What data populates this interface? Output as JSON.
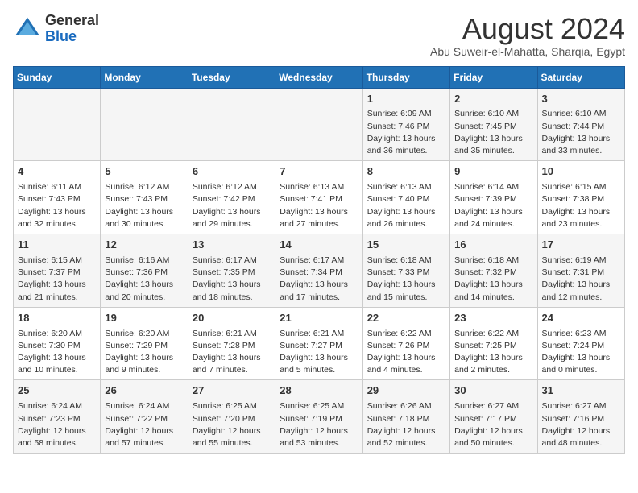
{
  "logo": {
    "general": "General",
    "blue": "Blue"
  },
  "title": "August 2024",
  "location": "Abu Suweir-el-Mahatta, Sharqia, Egypt",
  "days_header": [
    "Sunday",
    "Monday",
    "Tuesday",
    "Wednesday",
    "Thursday",
    "Friday",
    "Saturday"
  ],
  "weeks": [
    [
      {
        "day": "",
        "info": ""
      },
      {
        "day": "",
        "info": ""
      },
      {
        "day": "",
        "info": ""
      },
      {
        "day": "",
        "info": ""
      },
      {
        "day": "1",
        "info": "Sunrise: 6:09 AM\nSunset: 7:46 PM\nDaylight: 13 hours\nand 36 minutes."
      },
      {
        "day": "2",
        "info": "Sunrise: 6:10 AM\nSunset: 7:45 PM\nDaylight: 13 hours\nand 35 minutes."
      },
      {
        "day": "3",
        "info": "Sunrise: 6:10 AM\nSunset: 7:44 PM\nDaylight: 13 hours\nand 33 minutes."
      }
    ],
    [
      {
        "day": "4",
        "info": "Sunrise: 6:11 AM\nSunset: 7:43 PM\nDaylight: 13 hours\nand 32 minutes."
      },
      {
        "day": "5",
        "info": "Sunrise: 6:12 AM\nSunset: 7:43 PM\nDaylight: 13 hours\nand 30 minutes."
      },
      {
        "day": "6",
        "info": "Sunrise: 6:12 AM\nSunset: 7:42 PM\nDaylight: 13 hours\nand 29 minutes."
      },
      {
        "day": "7",
        "info": "Sunrise: 6:13 AM\nSunset: 7:41 PM\nDaylight: 13 hours\nand 27 minutes."
      },
      {
        "day": "8",
        "info": "Sunrise: 6:13 AM\nSunset: 7:40 PM\nDaylight: 13 hours\nand 26 minutes."
      },
      {
        "day": "9",
        "info": "Sunrise: 6:14 AM\nSunset: 7:39 PM\nDaylight: 13 hours\nand 24 minutes."
      },
      {
        "day": "10",
        "info": "Sunrise: 6:15 AM\nSunset: 7:38 PM\nDaylight: 13 hours\nand 23 minutes."
      }
    ],
    [
      {
        "day": "11",
        "info": "Sunrise: 6:15 AM\nSunset: 7:37 PM\nDaylight: 13 hours\nand 21 minutes."
      },
      {
        "day": "12",
        "info": "Sunrise: 6:16 AM\nSunset: 7:36 PM\nDaylight: 13 hours\nand 20 minutes."
      },
      {
        "day": "13",
        "info": "Sunrise: 6:17 AM\nSunset: 7:35 PM\nDaylight: 13 hours\nand 18 minutes."
      },
      {
        "day": "14",
        "info": "Sunrise: 6:17 AM\nSunset: 7:34 PM\nDaylight: 13 hours\nand 17 minutes."
      },
      {
        "day": "15",
        "info": "Sunrise: 6:18 AM\nSunset: 7:33 PM\nDaylight: 13 hours\nand 15 minutes."
      },
      {
        "day": "16",
        "info": "Sunrise: 6:18 AM\nSunset: 7:32 PM\nDaylight: 13 hours\nand 14 minutes."
      },
      {
        "day": "17",
        "info": "Sunrise: 6:19 AM\nSunset: 7:31 PM\nDaylight: 13 hours\nand 12 minutes."
      }
    ],
    [
      {
        "day": "18",
        "info": "Sunrise: 6:20 AM\nSunset: 7:30 PM\nDaylight: 13 hours\nand 10 minutes."
      },
      {
        "day": "19",
        "info": "Sunrise: 6:20 AM\nSunset: 7:29 PM\nDaylight: 13 hours\nand 9 minutes."
      },
      {
        "day": "20",
        "info": "Sunrise: 6:21 AM\nSunset: 7:28 PM\nDaylight: 13 hours\nand 7 minutes."
      },
      {
        "day": "21",
        "info": "Sunrise: 6:21 AM\nSunset: 7:27 PM\nDaylight: 13 hours\nand 5 minutes."
      },
      {
        "day": "22",
        "info": "Sunrise: 6:22 AM\nSunset: 7:26 PM\nDaylight: 13 hours\nand 4 minutes."
      },
      {
        "day": "23",
        "info": "Sunrise: 6:22 AM\nSunset: 7:25 PM\nDaylight: 13 hours\nand 2 minutes."
      },
      {
        "day": "24",
        "info": "Sunrise: 6:23 AM\nSunset: 7:24 PM\nDaylight: 13 hours\nand 0 minutes."
      }
    ],
    [
      {
        "day": "25",
        "info": "Sunrise: 6:24 AM\nSunset: 7:23 PM\nDaylight: 12 hours\nand 58 minutes."
      },
      {
        "day": "26",
        "info": "Sunrise: 6:24 AM\nSunset: 7:22 PM\nDaylight: 12 hours\nand 57 minutes."
      },
      {
        "day": "27",
        "info": "Sunrise: 6:25 AM\nSunset: 7:20 PM\nDaylight: 12 hours\nand 55 minutes."
      },
      {
        "day": "28",
        "info": "Sunrise: 6:25 AM\nSunset: 7:19 PM\nDaylight: 12 hours\nand 53 minutes."
      },
      {
        "day": "29",
        "info": "Sunrise: 6:26 AM\nSunset: 7:18 PM\nDaylight: 12 hours\nand 52 minutes."
      },
      {
        "day": "30",
        "info": "Sunrise: 6:27 AM\nSunset: 7:17 PM\nDaylight: 12 hours\nand 50 minutes."
      },
      {
        "day": "31",
        "info": "Sunrise: 6:27 AM\nSunset: 7:16 PM\nDaylight: 12 hours\nand 48 minutes."
      }
    ]
  ]
}
